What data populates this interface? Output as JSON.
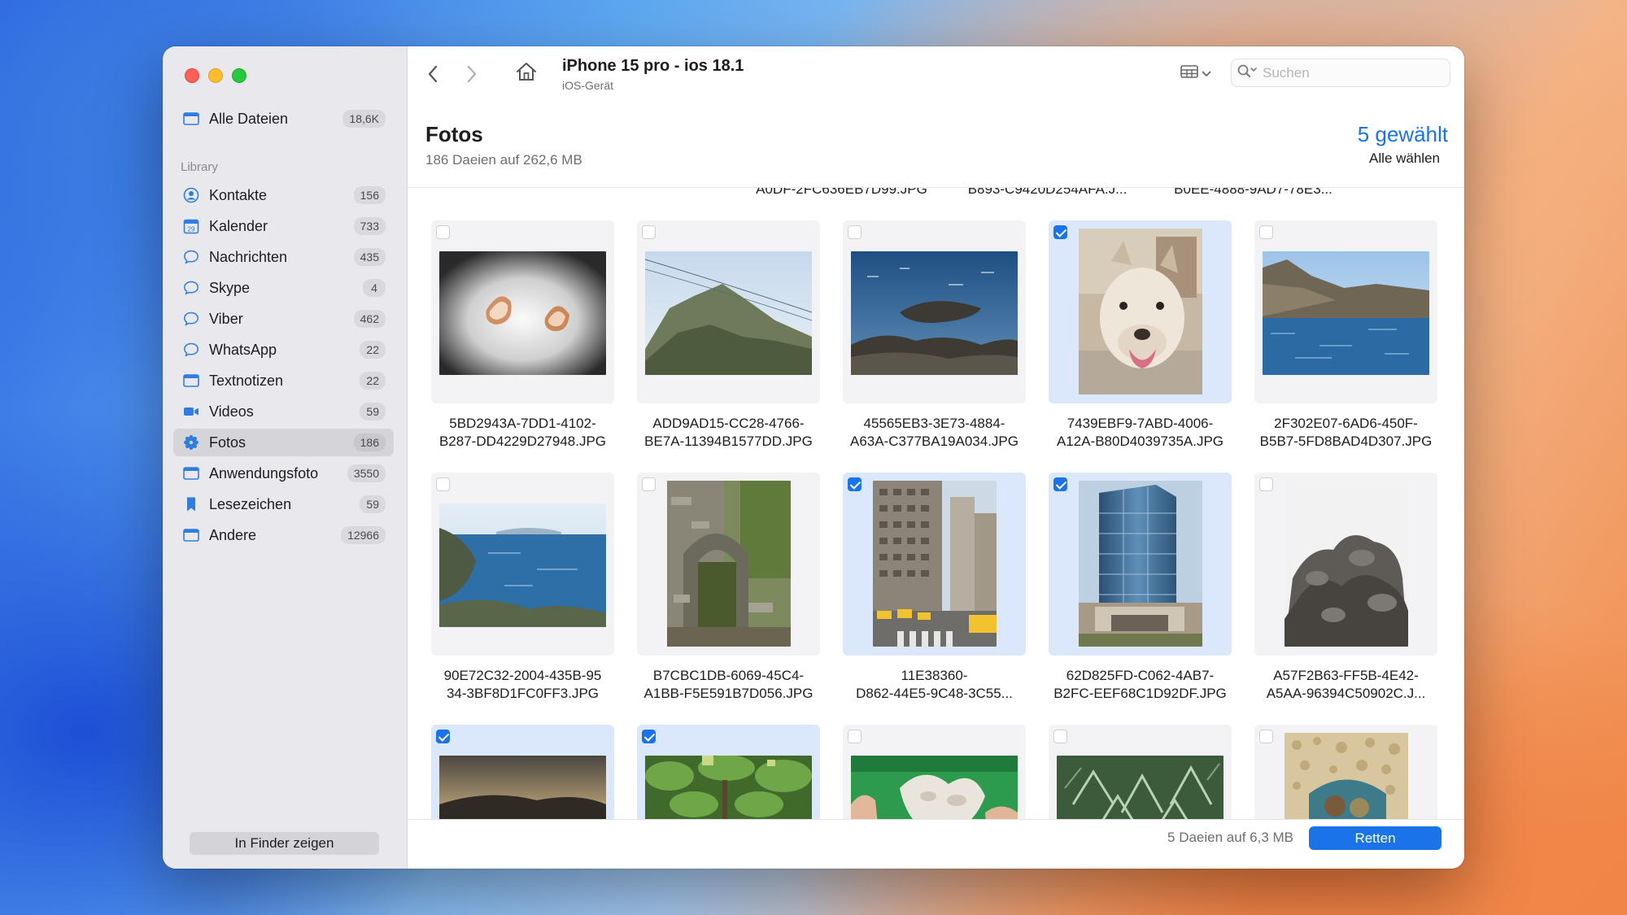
{
  "window": {
    "device_title": "iPhone 15 pro - ios 18.1",
    "device_subtitle": "iOS-Gerät",
    "search_placeholder": "Suchen"
  },
  "sidebar": {
    "all_files": {
      "label": "Alle Dateien",
      "count": "18,6K",
      "icon": "files-icon"
    },
    "section_title": "Library",
    "items": [
      {
        "label": "Kontakte",
        "count": "156",
        "icon": "contacts-icon"
      },
      {
        "label": "Kalender",
        "count": "733",
        "icon": "calendar-icon"
      },
      {
        "label": "Nachrichten",
        "count": "435",
        "icon": "chat-bubble-icon"
      },
      {
        "label": "Skype",
        "count": "4",
        "icon": "chat-bubble-icon"
      },
      {
        "label": "Viber",
        "count": "462",
        "icon": "chat-bubble-icon"
      },
      {
        "label": "WhatsApp",
        "count": "22",
        "icon": "chat-bubble-icon"
      },
      {
        "label": "Textnotizen",
        "count": "22",
        "icon": "notes-icon"
      },
      {
        "label": "Videos",
        "count": "59",
        "icon": "video-icon"
      },
      {
        "label": "Fotos",
        "count": "186",
        "icon": "photos-icon",
        "active": true
      },
      {
        "label": "Anwendungsfoto",
        "count": "3550",
        "icon": "app-photo-icon"
      },
      {
        "label": "Lesezeichen",
        "count": "59",
        "icon": "bookmark-icon"
      },
      {
        "label": "Andere",
        "count": "12966",
        "icon": "other-icon"
      }
    ],
    "finder_button": "In Finder zeigen"
  },
  "content": {
    "title": "Fotos",
    "subtitle": "186 Daeien auf 262,6 MB",
    "selected_count": "5 gewählt",
    "select_all": "Alle wählen",
    "cut_labels": [
      "A0DF-2FC636EB7D99.JPG",
      "B893-C9420D254AFA.J...",
      "B0EE-4888-9AD7-78E3..."
    ],
    "row1": [
      {
        "name_line1": "5BD2943A-7DD1-4102-",
        "name_line2": "B287-DD4229D27948.JPG",
        "checked": false
      },
      {
        "name_line1": "ADD9AD15-CC28-4766-",
        "name_line2": "BE7A-11394B1577DD.JPG",
        "checked": false
      },
      {
        "name_line1": "45565EB3-3E73-4884-",
        "name_line2": "A63A-C377BA19A034.JPG",
        "checked": false
      },
      {
        "name_line1": "7439EBF9-7ABD-4006-",
        "name_line2": "A12A-B80D4039735A.JPG",
        "checked": true
      },
      {
        "name_line1": "2F302E07-6AD6-450F-",
        "name_line2": "B5B7-5FD8BAD4D307.JPG",
        "checked": false
      }
    ],
    "row2": [
      {
        "name_line1": "90E72C32-2004-435B-95",
        "name_line2": "34-3BF8D1FC0FF3.JPG",
        "checked": false
      },
      {
        "name_line1": "B7CBC1DB-6069-45C4-",
        "name_line2": "A1BB-F5E591B7D056.JPG",
        "checked": false
      },
      {
        "name_line1": "11E38360-",
        "name_line2": "D862-44E5-9C48-3C55...",
        "checked": true
      },
      {
        "name_line1": "62D825FD-C062-4AB7-",
        "name_line2": "B2FC-EEF68C1D92DF.JPG",
        "checked": true
      },
      {
        "name_line1": "A57F2B63-FF5B-4E42-",
        "name_line2": "A5AA-96394C50902C.J...",
        "checked": false
      }
    ],
    "row3_checked": [
      true,
      true,
      false,
      false,
      false
    ]
  },
  "footer": {
    "info": "5 Daeien auf 6,3 MB",
    "recover_button": "Retten"
  },
  "colors": {
    "accent": "#1a73e8",
    "selected_tile": "#dbe8fb",
    "sidebar_bg": "#e9e8ec"
  }
}
